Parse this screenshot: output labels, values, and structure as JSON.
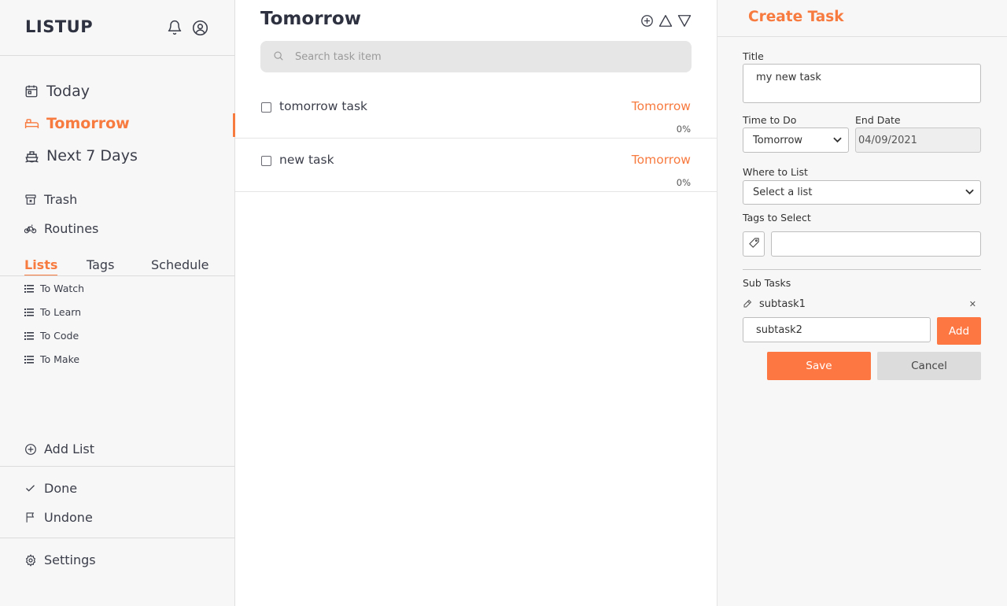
{
  "app": {
    "brand": "LISTUP"
  },
  "sidebar": {
    "nav": [
      {
        "label": "Today",
        "icon": "calendar-icon"
      },
      {
        "label": "Tomorrow",
        "icon": "bed-icon",
        "active": true
      },
      {
        "label": "Next 7 Days",
        "icon": "ship-icon"
      }
    ],
    "secondary": [
      {
        "label": "Trash",
        "icon": "trash-icon"
      },
      {
        "label": "Routines",
        "icon": "bicycle-icon"
      }
    ],
    "tabs": [
      {
        "label": "Lists",
        "active": true
      },
      {
        "label": "Tags"
      },
      {
        "label": "Schedule"
      }
    ],
    "lists": [
      "To Watch",
      "To Learn",
      "To Code",
      "To Make"
    ],
    "add_list": "Add List",
    "done": "Done",
    "undone": "Undone",
    "settings": "Settings"
  },
  "main": {
    "title": "Tomorrow",
    "search_placeholder": "Search task item",
    "tasks": [
      {
        "name": "tomorrow task",
        "when": "Tomorrow",
        "progress": "0%"
      },
      {
        "name": "new task",
        "when": "Tomorrow",
        "progress": "0%"
      }
    ]
  },
  "panel": {
    "title": "Create Task",
    "title_label": "Title",
    "title_value": "my new task",
    "time_label": "Time to Do",
    "time_value": "Tomorrow",
    "end_label": "End Date",
    "end_value": "04/09/2021",
    "where_label": "Where to List",
    "where_value": "Select a list",
    "tags_label": "Tags to Select",
    "subtasks_label": "Sub Tasks",
    "subtasks": [
      "subtask1"
    ],
    "subtask_input": "subtask2",
    "add_label": "Add",
    "save_label": "Save",
    "cancel_label": "Cancel"
  },
  "colors": {
    "accent": "#f77a3f",
    "button": "#fd7743"
  }
}
